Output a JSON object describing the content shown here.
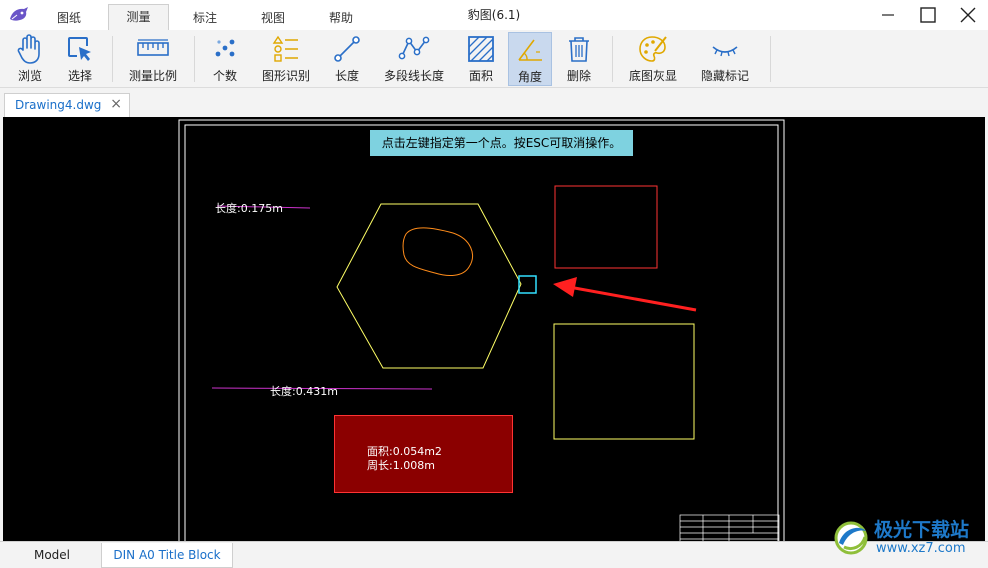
{
  "app": {
    "title": "豹图(6.1)"
  },
  "menu": {
    "tabs": [
      "图纸",
      "测量",
      "标注",
      "视图",
      "帮助"
    ],
    "active": "测量"
  },
  "toolbar": {
    "tools": [
      {
        "label": "浏览",
        "icon": "hand-icon"
      },
      {
        "label": "选择",
        "icon": "select-cursor-icon"
      },
      {
        "label": "测量比例",
        "icon": "ruler-icon"
      },
      {
        "label": "个数",
        "icon": "dots-icon"
      },
      {
        "label": "图形识别",
        "icon": "shape-list-icon"
      },
      {
        "label": "长度",
        "icon": "line-length-icon"
      },
      {
        "label": "多段线长度",
        "icon": "polyline-icon"
      },
      {
        "label": "面积",
        "icon": "area-hatch-icon"
      },
      {
        "label": "角度",
        "icon": "angle-icon"
      },
      {
        "label": "删除",
        "icon": "trash-icon"
      },
      {
        "label": "底图灰显",
        "icon": "palette-icon"
      },
      {
        "label": "隐藏标记",
        "icon": "eye-closed-icon"
      }
    ],
    "active": "角度"
  },
  "document_tab": {
    "label": "Drawing4.dwg",
    "close": "×"
  },
  "canvas": {
    "hint": "点击左键指定第一个点。按ESC可取消操作。",
    "measure1": "长度:0.175m",
    "measure2": "长度:0.431m",
    "area_line1": "面积:0.054m2",
    "area_line2": "周长:1.008m"
  },
  "bottom_tabs": {
    "model": "Model",
    "layout": "DIN A0 Title Block"
  },
  "watermark": {
    "name": "极光下载站",
    "url": "www.xz7.com"
  },
  "colors": {
    "accent": "#1a6fc9",
    "hint_bg": "#7ed2e0",
    "hexagon": "#ffff66",
    "arrow": "#ff2020",
    "magenta_line": "#cc33cc",
    "area_fill": "#8b0000"
  }
}
